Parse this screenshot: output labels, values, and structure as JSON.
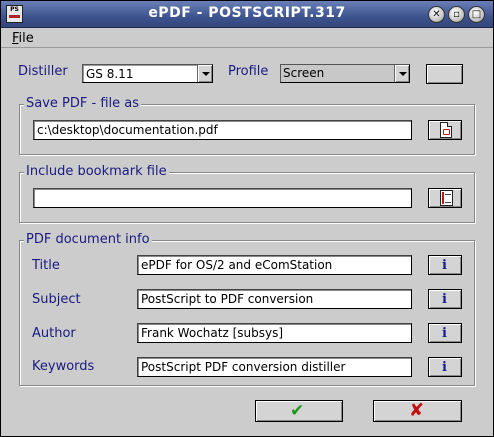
{
  "window": {
    "title": "ePDF - POSTSCRIPT.317",
    "icon_text": "PS",
    "title_bar_color": "#3e548f"
  },
  "menu": {
    "file_label": "File",
    "file_mnemonic": "F",
    "file_rest": "ile"
  },
  "distiller": {
    "label": "Distiller",
    "value": "GS 8.11"
  },
  "profile": {
    "label": "Profile",
    "value": "Screen"
  },
  "save_pdf": {
    "group_title": "Save PDF - file as",
    "value": "c:\\desktop\\documentation.pdf",
    "button_icon": "pdf-file-icon"
  },
  "bookmark": {
    "group_title": "Include bookmark file",
    "value": "",
    "button_icon": "bookmark-file-icon"
  },
  "doc_info": {
    "group_title": "PDF document info",
    "fields": [
      {
        "label": "Title",
        "value": "ePDF for OS/2 and eComStation"
      },
      {
        "label": "Subject",
        "value": "PostScript to PDF conversion"
      },
      {
        "label": "Author",
        "value": "Frank Wochatz [subsys]"
      },
      {
        "label": "Keywords",
        "value": "PostScript PDF conversion distiller"
      }
    ],
    "info_glyph": "i"
  },
  "actions": {
    "ok_glyph": "✔",
    "cancel_glyph": "✘",
    "ok_color": "#1a9a1a",
    "cancel_color": "#c01010"
  }
}
